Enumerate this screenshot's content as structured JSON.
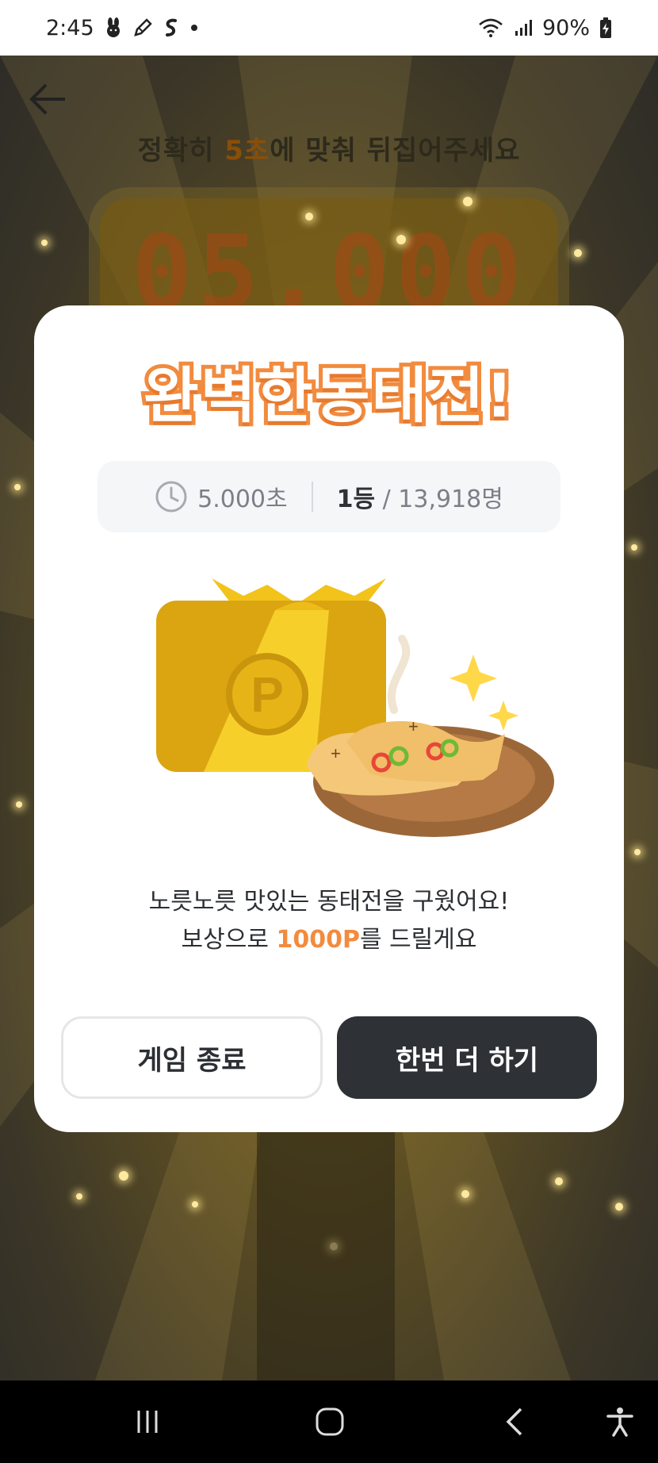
{
  "status_bar": {
    "time": "2:45",
    "battery": "90%",
    "icons": [
      "rabbit-icon",
      "pencil-icon",
      "swirl-icon",
      "dot-icon",
      "wifi-icon",
      "signal-icon",
      "battery-charging-icon"
    ]
  },
  "game": {
    "instruction_before": "정확히 ",
    "instruction_highlight": "5초",
    "instruction_after": "에 맞춰 뒤집어주세요",
    "timer_display": "05.000"
  },
  "modal": {
    "title": "완벽한동태전!",
    "result_time": "5.000초",
    "rank": "1등",
    "rank_total": " / 13,918명",
    "message_line1": "노릇노릇 맛있는 동태전을 구웠어요!",
    "message_line2_before": "보상으로 ",
    "message_line2_points": "1000P",
    "message_line2_after": "를 드릴게요",
    "quit_label": "게임 종료",
    "retry_label": "한번 더 하기"
  },
  "colors": {
    "accent_orange": "#f28b3e",
    "dark_button": "#2e3236",
    "modal_bg": "#ffffff"
  }
}
